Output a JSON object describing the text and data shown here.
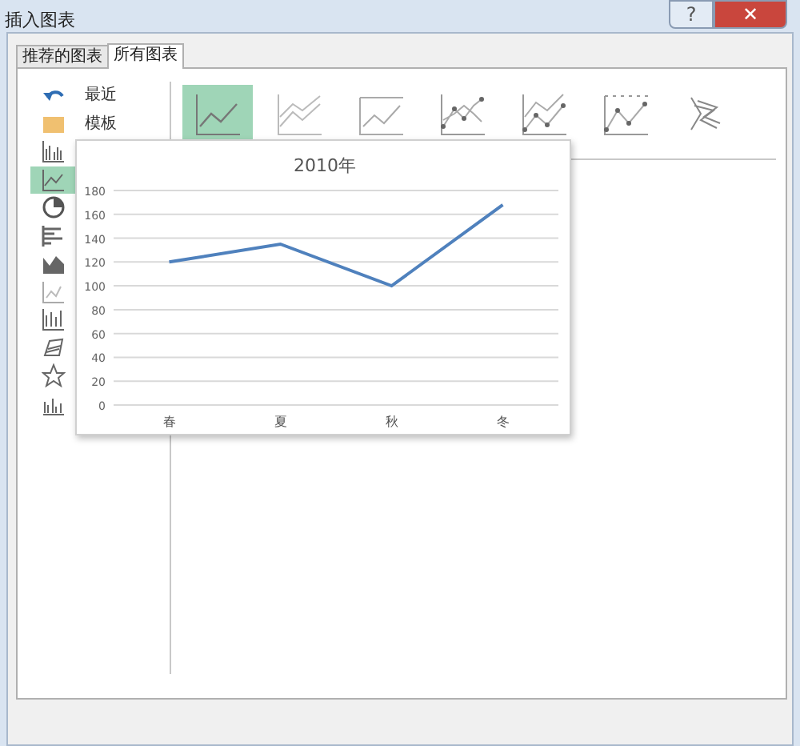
{
  "window": {
    "title": "插入图表",
    "buttons": [
      {
        "kind": "help",
        "label": "?"
      },
      {
        "kind": "close",
        "label": "✕"
      }
    ]
  },
  "tabs": [
    {
      "label": "推荐的图表",
      "selected": false
    },
    {
      "label": "所有图表",
      "selected": true
    }
  ],
  "sidebar": {
    "items": [
      {
        "kind": "recent",
        "label": "最近",
        "selected": false
      },
      {
        "kind": "template",
        "label": "模板",
        "selected": false
      },
      {
        "kind": "column",
        "selected": false
      },
      {
        "kind": "line",
        "selected": true
      },
      {
        "kind": "pie",
        "selected": false
      },
      {
        "kind": "bar",
        "selected": false
      },
      {
        "kind": "area",
        "selected": false
      },
      {
        "kind": "scatter",
        "selected": false
      },
      {
        "kind": "stock",
        "selected": false
      },
      {
        "kind": "surface",
        "selected": false
      },
      {
        "kind": "radar",
        "selected": false
      },
      {
        "kind": "combo",
        "selected": false
      }
    ]
  },
  "subtypes": [
    {
      "kind": "line",
      "selected": true
    },
    {
      "kind": "stacked-line",
      "selected": false
    },
    {
      "kind": "percent-line",
      "selected": false
    },
    {
      "kind": "line-markers",
      "selected": false
    },
    {
      "kind": "stacked-markers",
      "selected": false
    },
    {
      "kind": "percent-markers",
      "selected": false
    },
    {
      "kind": "line-3d",
      "selected": false
    }
  ],
  "preview": {
    "chart_data": {
      "type": "line",
      "title": "2010年",
      "categories": [
        "春",
        "夏",
        "秋",
        "冬"
      ],
      "series": [
        {
          "color": "#4f81bd",
          "values": [
            120,
            135,
            100,
            168
          ]
        }
      ],
      "grid": true,
      "ylim": [
        0,
        180
      ],
      "yticks": [
        0,
        20,
        40,
        60,
        80,
        100,
        120,
        140,
        160,
        180
      ]
    }
  }
}
